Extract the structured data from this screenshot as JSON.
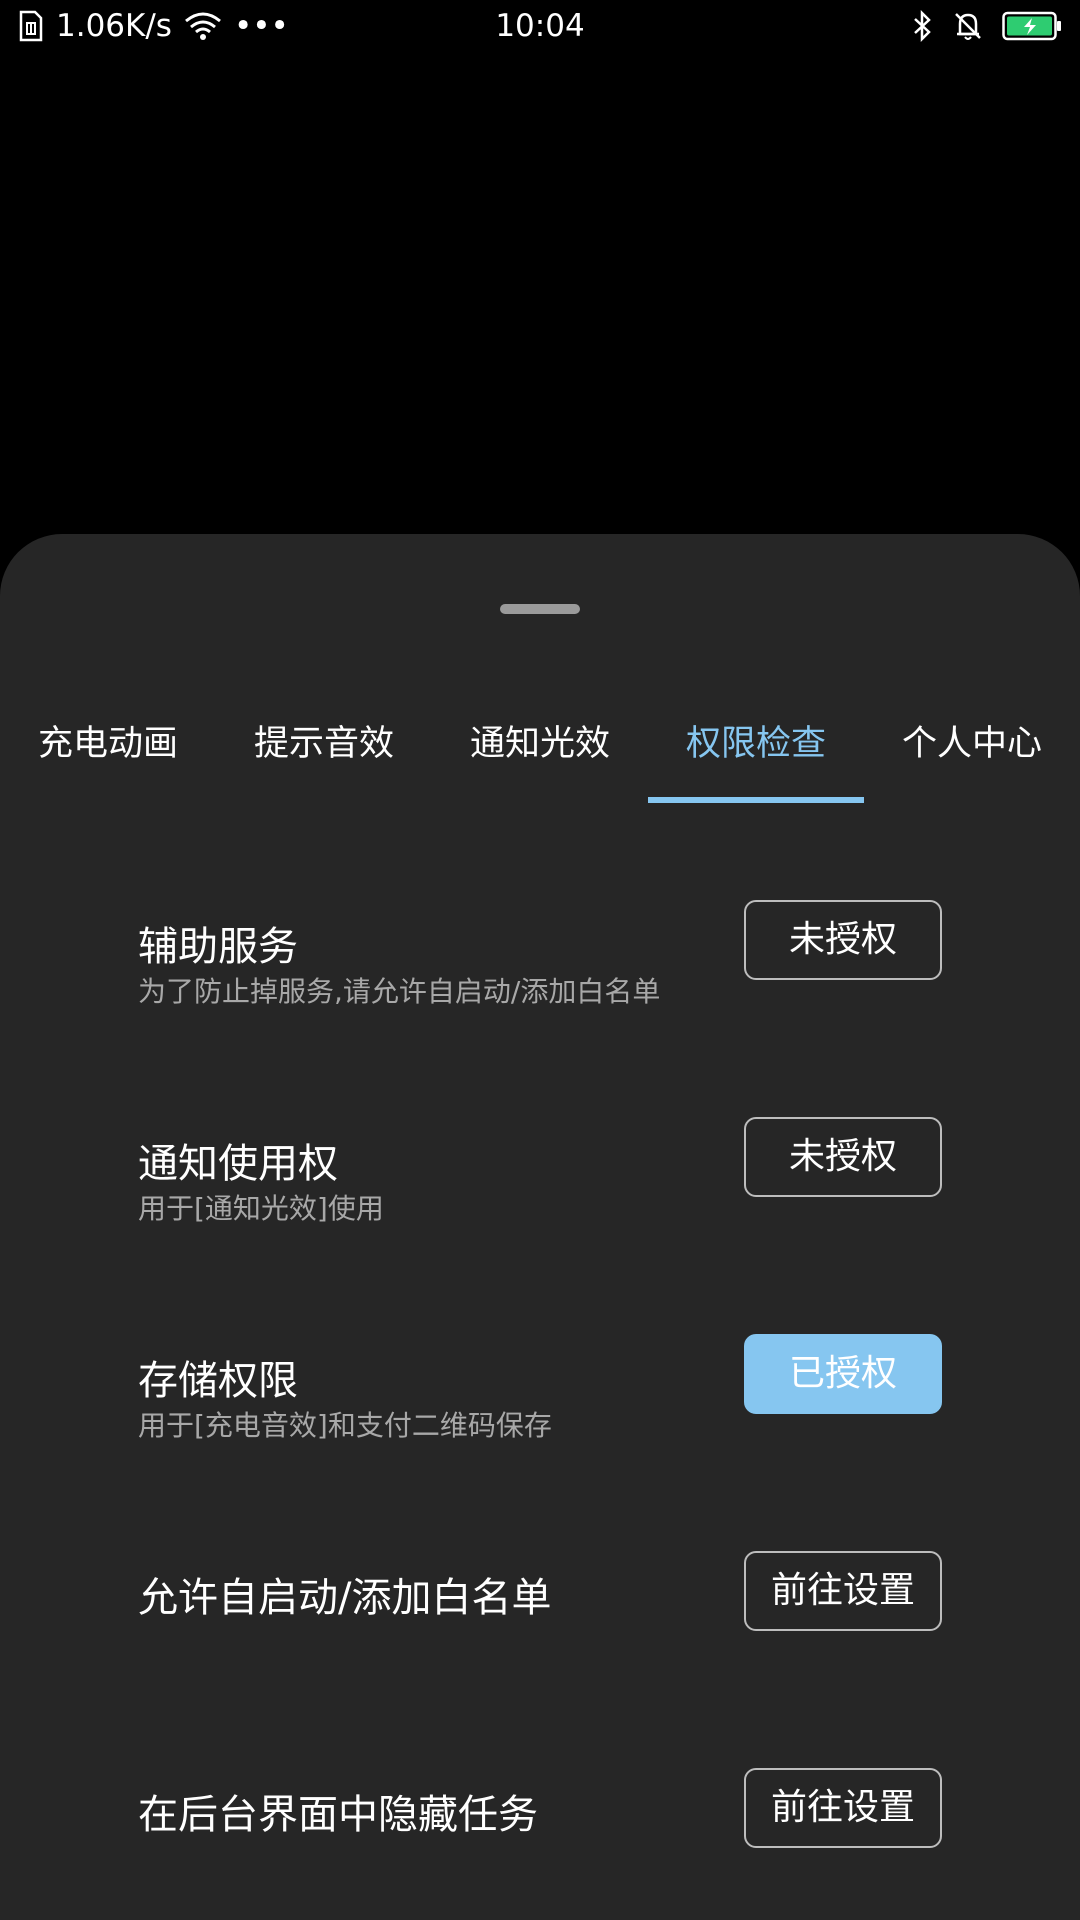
{
  "status_bar": {
    "network_speed": "1.06K/s",
    "more_dots": "•••",
    "time": "10:04",
    "icons": [
      "sim-icon",
      "wifi-icon",
      "bluetooth-icon",
      "bell-muted-icon",
      "battery-charging-icon"
    ],
    "battery_color": "#2ecc71"
  },
  "tabs": [
    {
      "label": "充电动画",
      "active": false
    },
    {
      "label": "提示音效",
      "active": false
    },
    {
      "label": "通知光效",
      "active": false
    },
    {
      "label": "权限检查",
      "active": true
    },
    {
      "label": "个人中心",
      "active": false
    }
  ],
  "accent_color": "#86c6f0",
  "permissions": [
    {
      "title": "辅助服务",
      "description": "为了防止掉服务,请允许自启动/添加白名单",
      "button": "未授权",
      "granted": false
    },
    {
      "title": "通知使用权",
      "description": "用于[通知光效]使用",
      "button": "未授权",
      "granted": false
    },
    {
      "title": "存储权限",
      "description": "用于[充电音效]和支付二维码保存",
      "button": "已授权",
      "granted": true
    },
    {
      "title": "允许自启动/添加白名单",
      "description": "",
      "button": "前往设置",
      "granted": false
    },
    {
      "title": "在后台界面中隐藏任务",
      "description": "",
      "button": "前往设置",
      "granted": false
    }
  ]
}
